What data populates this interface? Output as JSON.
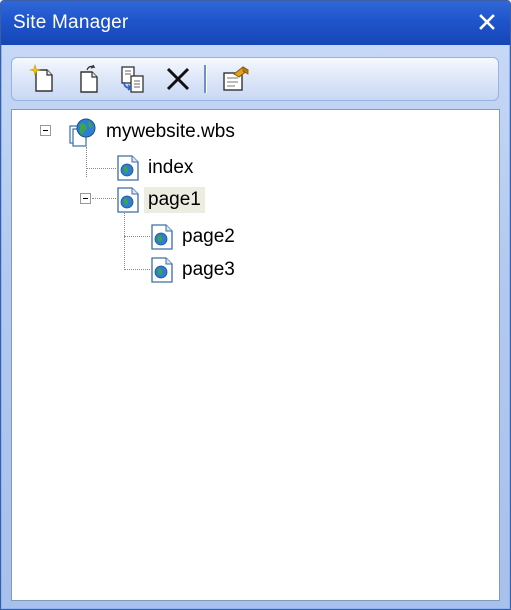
{
  "window": {
    "title": "Site Manager",
    "close_icon": "close-icon"
  },
  "toolbar": {
    "buttons": [
      {
        "name": "new-page-button",
        "icon": "new-page-icon"
      },
      {
        "name": "new-folder-button",
        "icon": "new-folder-icon"
      },
      {
        "name": "copy-page-button",
        "icon": "copy-page-icon"
      },
      {
        "name": "delete-button",
        "icon": "delete-icon"
      },
      {
        "name": "properties-button",
        "icon": "properties-icon"
      }
    ]
  },
  "tree": {
    "root": {
      "label": "mywebsite.wbs",
      "icon": "website-globe-icon",
      "expanded": true
    },
    "items": [
      {
        "label": "index",
        "icon": "web-page-icon"
      },
      {
        "label": "page1",
        "icon": "web-page-icon",
        "expanded": true,
        "selected": true
      },
      {
        "label": "page2",
        "icon": "web-page-icon"
      },
      {
        "label": "page3",
        "icon": "web-page-icon"
      }
    ]
  },
  "colors": {
    "title_bar": "#1f55cc",
    "selection": "#ecece0",
    "panel_bg": "#b3c9f0"
  }
}
